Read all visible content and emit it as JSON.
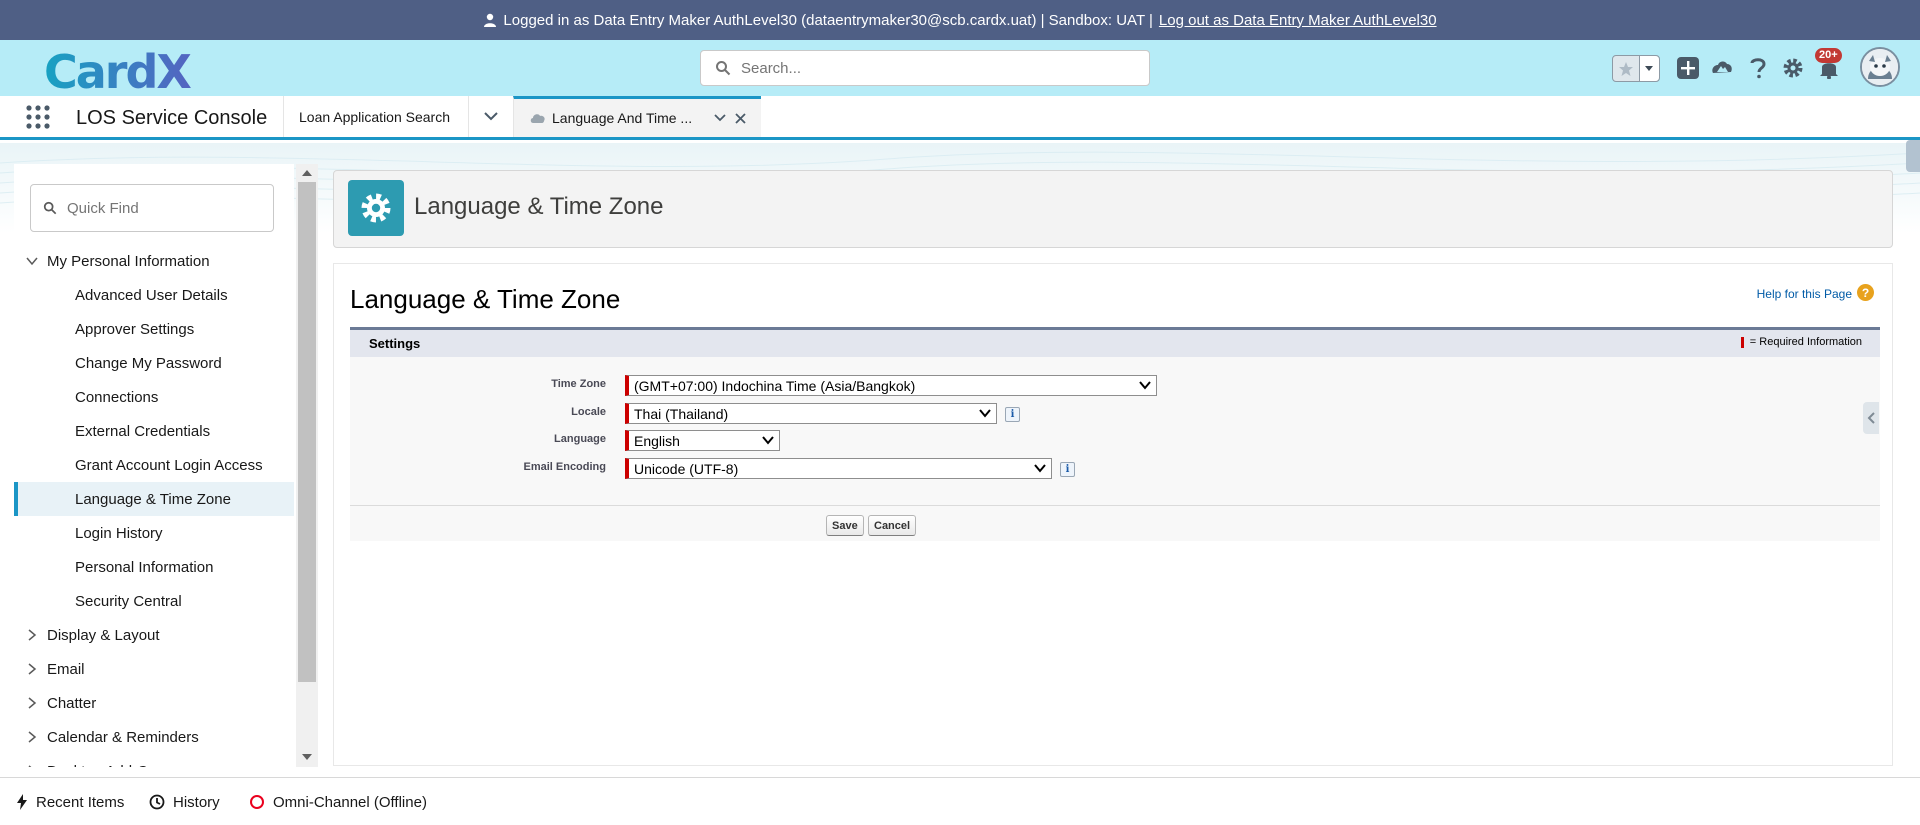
{
  "banner": {
    "text": "Logged in as Data Entry Maker AuthLevel30 (dataentrymaker30@scb.cardx.uat) | Sandbox: UAT |",
    "logout_link": "Log out as Data Entry Maker AuthLevel30"
  },
  "header": {
    "logo_text": "CardX",
    "search_placeholder": "Search...",
    "notification_count": "20+",
    "colors": {
      "header_bg": "#b6ecf7",
      "banner_bg": "#4f5f85",
      "accent": "#1b96c6"
    }
  },
  "nav": {
    "app_name": "LOS Service Console",
    "tabs": [
      {
        "label": "Loan Application Search"
      },
      {
        "label": "Language And Time ..."
      }
    ]
  },
  "sidebar": {
    "quick_find_placeholder": "Quick Find",
    "items": [
      {
        "label": "My Personal Information",
        "type": "parent",
        "expanded": true
      },
      {
        "label": "Advanced User Details",
        "type": "child"
      },
      {
        "label": "Approver Settings",
        "type": "child"
      },
      {
        "label": "Change My Password",
        "type": "child"
      },
      {
        "label": "Connections",
        "type": "child"
      },
      {
        "label": "External Credentials",
        "type": "child"
      },
      {
        "label": "Grant Account Login Access",
        "type": "child"
      },
      {
        "label": "Language & Time Zone",
        "type": "child",
        "selected": true
      },
      {
        "label": "Login History",
        "type": "child"
      },
      {
        "label": "Personal Information",
        "type": "child"
      },
      {
        "label": "Security Central",
        "type": "child"
      },
      {
        "label": "Display & Layout",
        "type": "parent",
        "expanded": false
      },
      {
        "label": "Email",
        "type": "parent",
        "expanded": false
      },
      {
        "label": "Chatter",
        "type": "parent",
        "expanded": false
      },
      {
        "label": "Calendar & Reminders",
        "type": "parent",
        "expanded": false
      },
      {
        "label": "Desktop Add-Ons",
        "type": "parent",
        "expanded": false
      }
    ]
  },
  "page": {
    "header_title": "Language & Time Zone",
    "title": "Language & Time Zone",
    "help_link": "Help for this Page",
    "section_title": "Settings",
    "required_info": "= Required Information",
    "fields": {
      "time_zone": {
        "label": "Time Zone",
        "value": "(GMT+07:00) Indochina Time (Asia/Bangkok)"
      },
      "locale": {
        "label": "Locale",
        "value": "Thai (Thailand)"
      },
      "language": {
        "label": "Language",
        "value": "English"
      },
      "email_encoding": {
        "label": "Email Encoding",
        "value": "Unicode (UTF-8)"
      }
    },
    "buttons": {
      "save": "Save",
      "cancel": "Cancel"
    }
  },
  "utility_bar": {
    "recent_items": "Recent Items",
    "history": "History",
    "omni_channel": "Omni-Channel (Offline)"
  }
}
